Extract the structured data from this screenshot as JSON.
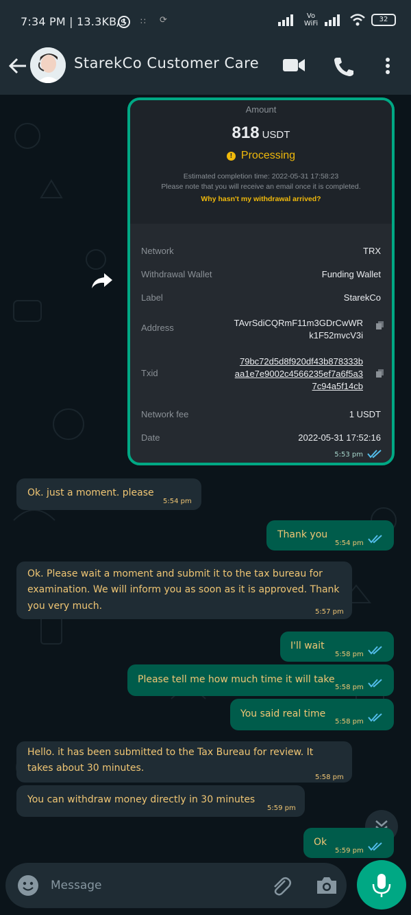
{
  "status": {
    "time_speed": "7:34 PM | 13.3KB/s",
    "vo_wifi": "Vo WiFi",
    "battery": "32"
  },
  "chat": {
    "contact_name": "StarekCo Customer Care"
  },
  "card": {
    "amount_label": "Amount",
    "amount_value": "818",
    "amount_currency": "USDT",
    "status": "Processing",
    "est_line1": "Estimated completion time: 2022-05-31 17:58:23",
    "est_line2": "Please note that you will receive an email once it is completed.",
    "why_link": "Why hasn't my withdrawal arrived?",
    "rows": [
      {
        "key": "Network",
        "value": "TRX"
      },
      {
        "key": "Withdrawal Wallet",
        "value": "Funding Wallet"
      },
      {
        "key": "Label",
        "value": "StarekCo"
      },
      {
        "key": "Address",
        "value1": "TAvrSdiCQRmF11m3GDrCwWR",
        "value2": "k1F52mvcV3i"
      },
      {
        "key": "Txid",
        "value1": "79bc72d5d8f920df43b878333b",
        "value2": "aa1e7e9002c4566235ef7a6f5a3",
        "value3": "7c94a5f14cb"
      },
      {
        "key": "Network fee",
        "value": "1 USDT"
      },
      {
        "key": "Date",
        "value": "2022-05-31 17:52:16"
      }
    ],
    "time": "5:53 pm"
  },
  "messages": [
    {
      "dir": "in",
      "text": "Ok. just a moment. please",
      "time": "5:54 pm"
    },
    {
      "dir": "out",
      "text": "Thank you",
      "time": "5:54 pm"
    },
    {
      "dir": "in",
      "text1": "Ok. Please wait a moment and submit it to the tax bureau for",
      "text2": "examination. We will inform you as soon as it is approved. Thank",
      "text3": "you very much.",
      "time": "5:57 pm"
    },
    {
      "dir": "out",
      "text": "I'll wait",
      "time": "5:58 pm"
    },
    {
      "dir": "out",
      "text": "Please tell me how much time it will take",
      "time": "5:58 pm"
    },
    {
      "dir": "out",
      "text": "You said real time",
      "time": "5:58 pm"
    },
    {
      "dir": "in",
      "text1": "Hello. it has been submitted to the Tax Bureau for review. It",
      "text2": "takes about 30 minutes.",
      "time": "5:58 pm"
    },
    {
      "dir": "in",
      "text": "You can withdraw money directly in 30 minutes",
      "time": "5:59 pm"
    },
    {
      "dir": "out",
      "text": "Ok",
      "time": "5:59 pm"
    }
  ],
  "composer": {
    "placeholder": "Message"
  },
  "colors": {
    "accent": "#00a884",
    "outgoing_bubble": "#005c4b",
    "incoming_bubble": "#1f2c34",
    "text_yellow": "#f0c674",
    "binance_yellow": "#f0b90b"
  }
}
